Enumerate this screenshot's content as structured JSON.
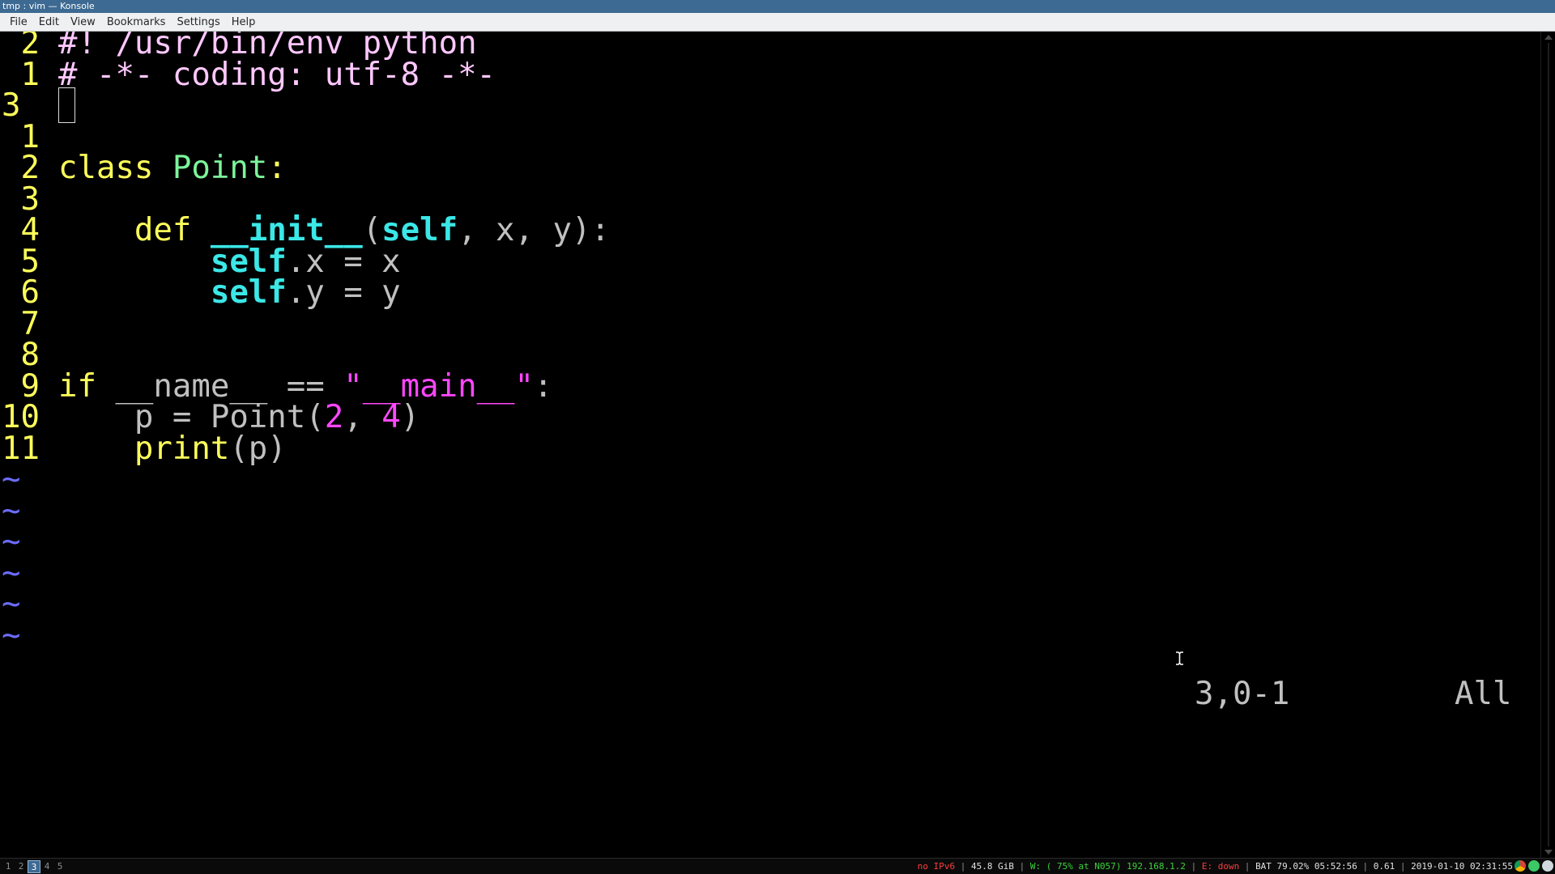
{
  "window": {
    "title": "tmp : vim — Konsole"
  },
  "menu": {
    "items": [
      "File",
      "Edit",
      "View",
      "Bookmarks",
      "Settings",
      "Help"
    ]
  },
  "colors": {
    "titlebar": "#3d6a92",
    "line_numbers": "#ffff5a",
    "keyword": "#ffff5a",
    "class_name": "#7cf59a",
    "builtin": "#3be7e7",
    "string": "#ff47ff",
    "tilde": "#6c6cff"
  },
  "editor": {
    "lines": [
      {
        "num": " 2",
        "tokens": [
          [
            "pre",
            "#! /usr/bin/env python"
          ]
        ]
      },
      {
        "num": " 1",
        "tokens": [
          [
            "pre",
            "# -*- coding: utf-8 -*-"
          ]
        ]
      },
      {
        "num": "3  ",
        "cursor": true,
        "tokens": []
      },
      {
        "num": " 1",
        "tokens": []
      },
      {
        "num": " 2",
        "tokens": [
          [
            "kw",
            "class "
          ],
          [
            "cls",
            "Point"
          ],
          [
            "kw",
            ":"
          ]
        ]
      },
      {
        "num": " 3",
        "tokens": []
      },
      {
        "num": " 4",
        "tokens": [
          [
            "txt",
            "    "
          ],
          [
            "kw",
            "def "
          ],
          [
            "bi",
            "__init__"
          ],
          [
            "txt",
            "("
          ],
          [
            "bi",
            "self"
          ],
          [
            "txt",
            ", x, y):"
          ]
        ]
      },
      {
        "num": " 5",
        "tokens": [
          [
            "txt",
            "        "
          ],
          [
            "bi",
            "self"
          ],
          [
            "txt",
            ".x = x"
          ]
        ]
      },
      {
        "num": " 6",
        "tokens": [
          [
            "txt",
            "        "
          ],
          [
            "bi",
            "self"
          ],
          [
            "txt",
            ".y = y"
          ]
        ]
      },
      {
        "num": " 7",
        "tokens": []
      },
      {
        "num": " 8",
        "tokens": []
      },
      {
        "num": " 9",
        "tokens": [
          [
            "kw",
            "if "
          ],
          [
            "txt",
            "__name__ == "
          ],
          [
            "str",
            "\"__main__\""
          ],
          [
            "txt",
            ":"
          ]
        ]
      },
      {
        "num": "10",
        "tokens": [
          [
            "txt",
            "    p = Point("
          ],
          [
            "num",
            "2"
          ],
          [
            "txt",
            ", "
          ],
          [
            "num",
            "4"
          ],
          [
            "txt",
            ")"
          ]
        ]
      },
      {
        "num": "11",
        "tokens": [
          [
            "txt",
            "    "
          ],
          [
            "kw",
            "print"
          ],
          [
            "txt",
            "(p)"
          ]
        ]
      }
    ],
    "tildes": [
      "~",
      "~",
      "~",
      "~",
      "~",
      "~"
    ],
    "status": {
      "position": "3,0-1",
      "scroll": "All"
    }
  },
  "panel": {
    "desktops": [
      "1",
      "2",
      "3",
      "4",
      "5"
    ],
    "active_desktop": "3",
    "status": {
      "ipv6": "no IPv6",
      "disk": "45.8 GiB",
      "wifi": "W: ( 75% at N057) 192.168.1.2",
      "ethernet": "E: down",
      "battery": "BAT 79.02% 05:52:56",
      "load": "0.61",
      "datetime": "2019-01-10 02:31:55"
    },
    "tray_icons": [
      "chrome-icon",
      "network-icon",
      "app-icon"
    ]
  }
}
